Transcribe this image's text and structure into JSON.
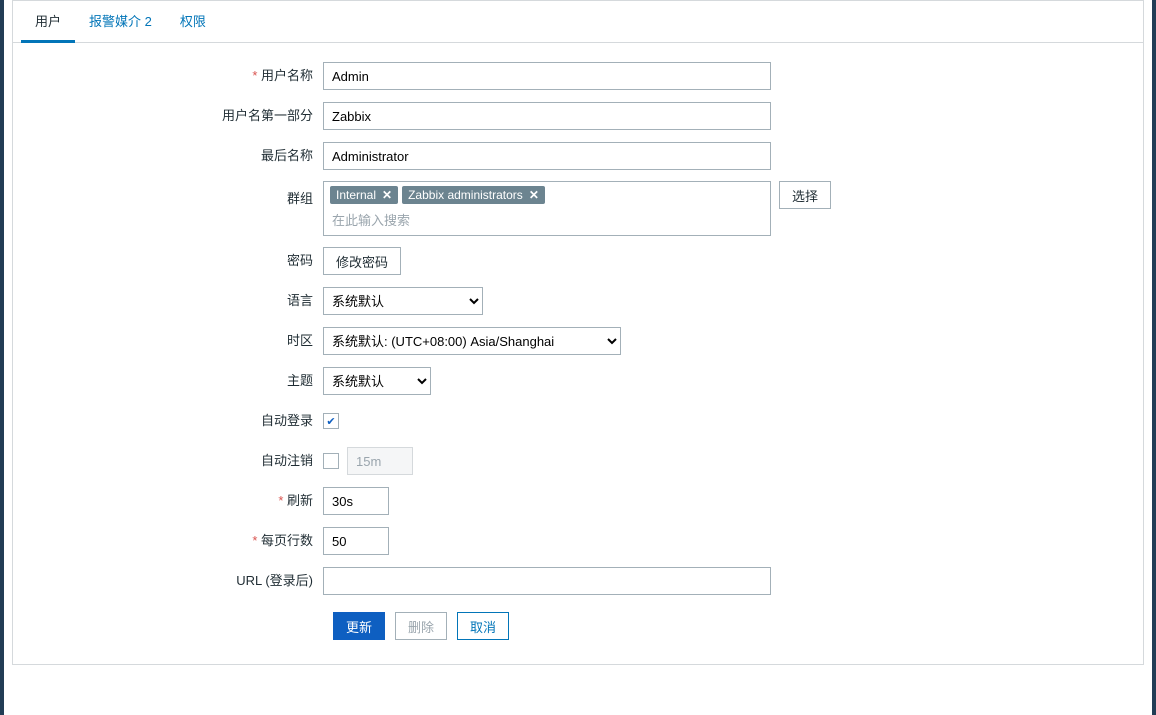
{
  "tabs": {
    "user": "用户",
    "media": "报警媒介 2",
    "perm": "权限"
  },
  "labels": {
    "username": "用户名称",
    "firstname": "用户名第一部分",
    "lastname": "最后名称",
    "groups": "群组",
    "password": "密码",
    "language": "语言",
    "timezone": "时区",
    "theme": "主题",
    "autologin": "自动登录",
    "autologout": "自动注销",
    "refresh": "刷新",
    "rows": "每页行数",
    "url": "URL (登录后)"
  },
  "values": {
    "username": "Admin",
    "firstname": "Zabbix",
    "lastname": "Administrator",
    "language": "系统默认",
    "timezone": "系统默认: (UTC+08:00) Asia/Shanghai",
    "theme": "系统默认",
    "autologout": "15m",
    "refresh": "30s",
    "rows": "50",
    "url": ""
  },
  "groups": {
    "tags": [
      "Internal",
      "Zabbix administrators"
    ],
    "placeholder": "在此输入搜索",
    "select_button": "选择"
  },
  "buttons": {
    "change_password": "修改密码",
    "update": "更新",
    "delete": "删除",
    "cancel": "取消"
  }
}
